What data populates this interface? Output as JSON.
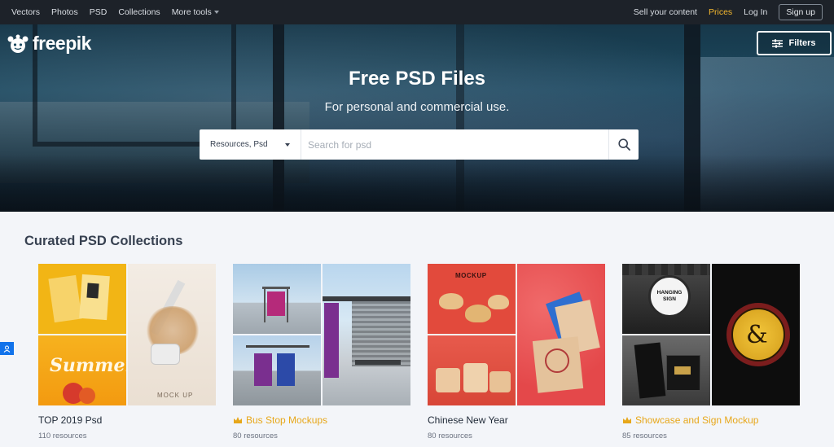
{
  "topnav": {
    "links": [
      "Vectors",
      "Photos",
      "PSD",
      "Collections",
      "More tools"
    ],
    "right": {
      "sell": "Sell your content",
      "prices": "Prices",
      "login": "Log In",
      "signup": "Sign up"
    }
  },
  "logo": {
    "text": "freepik"
  },
  "filters": {
    "label": "Filters"
  },
  "hero": {
    "title": "Free PSD Files",
    "subtitle": "For personal and commercial use."
  },
  "search": {
    "type_value": "Resources, Psd",
    "placeholder": "Search for psd"
  },
  "section": {
    "title": "Curated PSD Collections"
  },
  "collections": [
    {
      "name": "TOP 2019 Psd",
      "count": "110 resources",
      "premium": false,
      "thumb_texts": [
        "Summer",
        "MOCK UP"
      ]
    },
    {
      "name": "Bus Stop Mockups",
      "count": "80 resources",
      "premium": true
    },
    {
      "name": "Chinese New Year",
      "count": "80 resources",
      "premium": false,
      "thumb_texts": [
        "MOCKUP"
      ]
    },
    {
      "name": "Showcase and Sign Mockup",
      "count": "85 resources",
      "premium": true,
      "thumb_texts": [
        "HANGING SIGN"
      ]
    }
  ],
  "colors": {
    "nav_bg": "#1d2229",
    "premium": "#e7a71a",
    "prices": "#f5b82e",
    "accent_blue": "#1273eb"
  }
}
